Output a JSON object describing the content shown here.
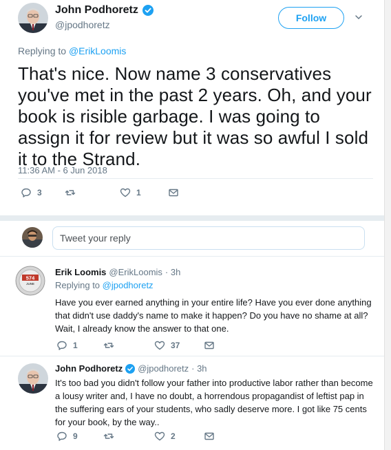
{
  "colors": {
    "accent": "#1da1f2",
    "muted": "#657786",
    "text": "#14171a",
    "border": "#e6ecf0"
  },
  "main_tweet": {
    "author_name": "John Podhoretz",
    "author_handle": "@jpodhoretz",
    "verified": true,
    "follow_label": "Follow",
    "replying_prefix": "Replying to ",
    "replying_handle": "@ErikLoomis",
    "text": "That's nice. Now name 3 conservatives you've met in the past 2 years. Oh, and your book is risible garbage. I was going to assign it for review but it was so awful I sold it to the Strand.",
    "timestamp": "11:36 AM - 6 Jun 2018",
    "replies": "3",
    "retweets": "",
    "likes": "1",
    "icons": [
      "reply-icon",
      "retweet-icon",
      "like-icon",
      "dm-icon",
      "chevron-down-icon",
      "verified-icon"
    ]
  },
  "composer": {
    "placeholder": "Tweet your reply"
  },
  "replies": [
    {
      "author_name": "Erik Loomis",
      "author_handle": "@ErikLoomis",
      "age": "· 3h",
      "verified": false,
      "replying_prefix": "Replying to ",
      "replying_handle": "@jpodhoretz",
      "avatar_text": {
        "number": "574",
        "word": "JUNE"
      },
      "text": "Have you ever earned anything in your entire life? Have you ever done anything that didn't use daddy's name to make it happen? Do you have no shame at all? Wait, I already know the answer to that one.",
      "replies": "1",
      "retweets": "",
      "likes": "37"
    },
    {
      "author_name": "John Podhoretz",
      "author_handle": "@jpodhoretz",
      "age": "· 3h",
      "verified": true,
      "text": "It's too bad you didn't follow your father into productive labor rather than become a lousy writer and, I have no doubt, a horrendous propagandist of leftist pap in the suffering ears of your students, who sadly deserve more. I got like 75 cents  for your book, by the way..",
      "replies": "9",
      "retweets": "",
      "likes": "2"
    }
  ]
}
